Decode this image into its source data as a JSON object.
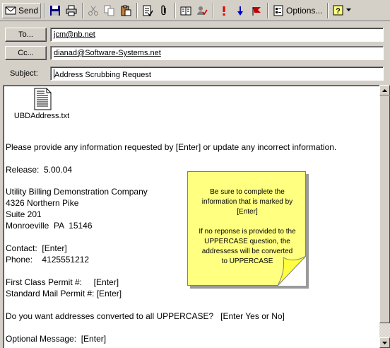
{
  "toolbar": {
    "send_label": "Send",
    "options_label": "Options...",
    "icons": [
      "send-icon",
      "save-icon",
      "print-icon",
      "cut-icon",
      "copy-icon",
      "paste-icon",
      "check-names-icon",
      "attachment-icon",
      "address-book-icon",
      "check-names-tick-icon",
      "high-importance-icon",
      "low-importance-icon",
      "flag-icon",
      "options-icon",
      "help-icon"
    ]
  },
  "header": {
    "to_button": "To...",
    "to_value": "jcm@nb.net",
    "cc_button": "Cc...",
    "cc_value": "dianad@Software-Systems.net",
    "subject_label": "Subject:",
    "subject_value": "Address Scrubbing Request"
  },
  "attachment": {
    "name": "UBDAddress.txt"
  },
  "message": {
    "intro": "Please provide any information requested by [Enter] or update any incorrect information.",
    "release": "Release:  5.00.04",
    "company": "Utility Billing Demonstration Company",
    "address1": "4326 Northern Pike",
    "address2": "Suite 201",
    "city": "Monroeville  PA  15146",
    "contact": "Contact:  [Enter]",
    "phone": "Phone:    4125551212",
    "first_class": "First Class Permit #:     [Enter]",
    "standard_mail": "Standard Mail Permit #: [Enter]",
    "uppercase_q": "Do you want addresses converted to all UPPERCASE?   [Enter Yes or No]",
    "optional_msg": "Optional Message:  [Enter]"
  },
  "note": {
    "text": "Be sure to complete the\ninformation that is marked by\n[Enter]\n\nIf no reponse is provided to the\nUPPERCASE question, the\naddressess will be converted\nto UPPERCASE"
  },
  "colors": {
    "note_bg": "#ffff80",
    "window_bg": "#d4d0c8"
  }
}
